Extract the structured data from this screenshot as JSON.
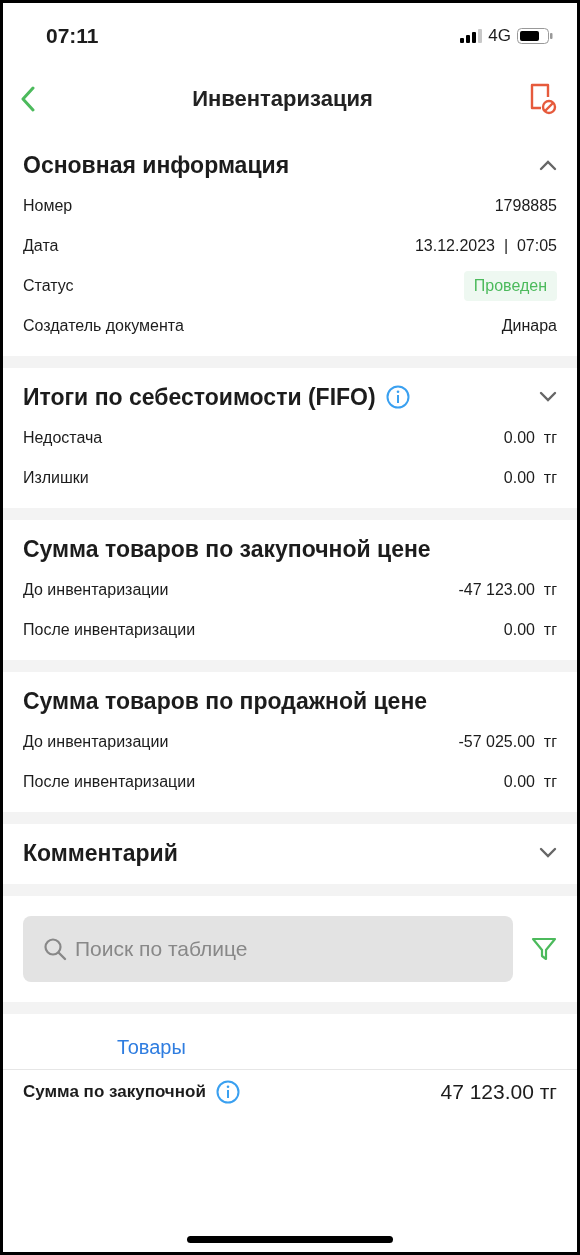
{
  "status_bar": {
    "time": "07:11",
    "network": "4G"
  },
  "nav": {
    "title": "Инвентаризация"
  },
  "sections": [
    {
      "title": "Основная информация",
      "expanded": true,
      "rows": [
        {
          "label": "Номер",
          "value": "1798885",
          "kind": "text"
        },
        {
          "label": "Дата",
          "value": "13.12.2023  |  07:05",
          "kind": "text"
        },
        {
          "label": "Статус",
          "value": "Проведен",
          "kind": "badge"
        },
        {
          "label": "Создатель документа",
          "value": "Динара",
          "kind": "text"
        }
      ]
    },
    {
      "title": "Итоги по себестоимости (FIFO)",
      "info": true,
      "expanded": false,
      "rows": [
        {
          "label": "Недостача",
          "value": "0.00  тг",
          "kind": "text"
        },
        {
          "label": "Излишки",
          "value": "0.00  тг",
          "kind": "text"
        }
      ]
    },
    {
      "title": "Сумма товаров по закупочной цене",
      "rows": [
        {
          "label": "До инвентаризации",
          "value": "-47 123.00  тг",
          "kind": "text"
        },
        {
          "label": "После инвентаризации",
          "value": "0.00  тг",
          "kind": "text"
        }
      ]
    },
    {
      "title": "Сумма товаров по продажной цене",
      "rows": [
        {
          "label": "До инвентаризации",
          "value": "-57 025.00  тг",
          "kind": "text"
        },
        {
          "label": "После инвентаризации",
          "value": "0.00  тг",
          "kind": "text"
        }
      ]
    },
    {
      "title": "Комментарий",
      "expanded": false
    }
  ],
  "search": {
    "placeholder": "Поиск по таблице"
  },
  "tabs": [
    {
      "label": "Товары",
      "selected": true
    }
  ],
  "summary": {
    "label": "Сумма по закупочной",
    "value": "47 123.00 тг"
  }
}
